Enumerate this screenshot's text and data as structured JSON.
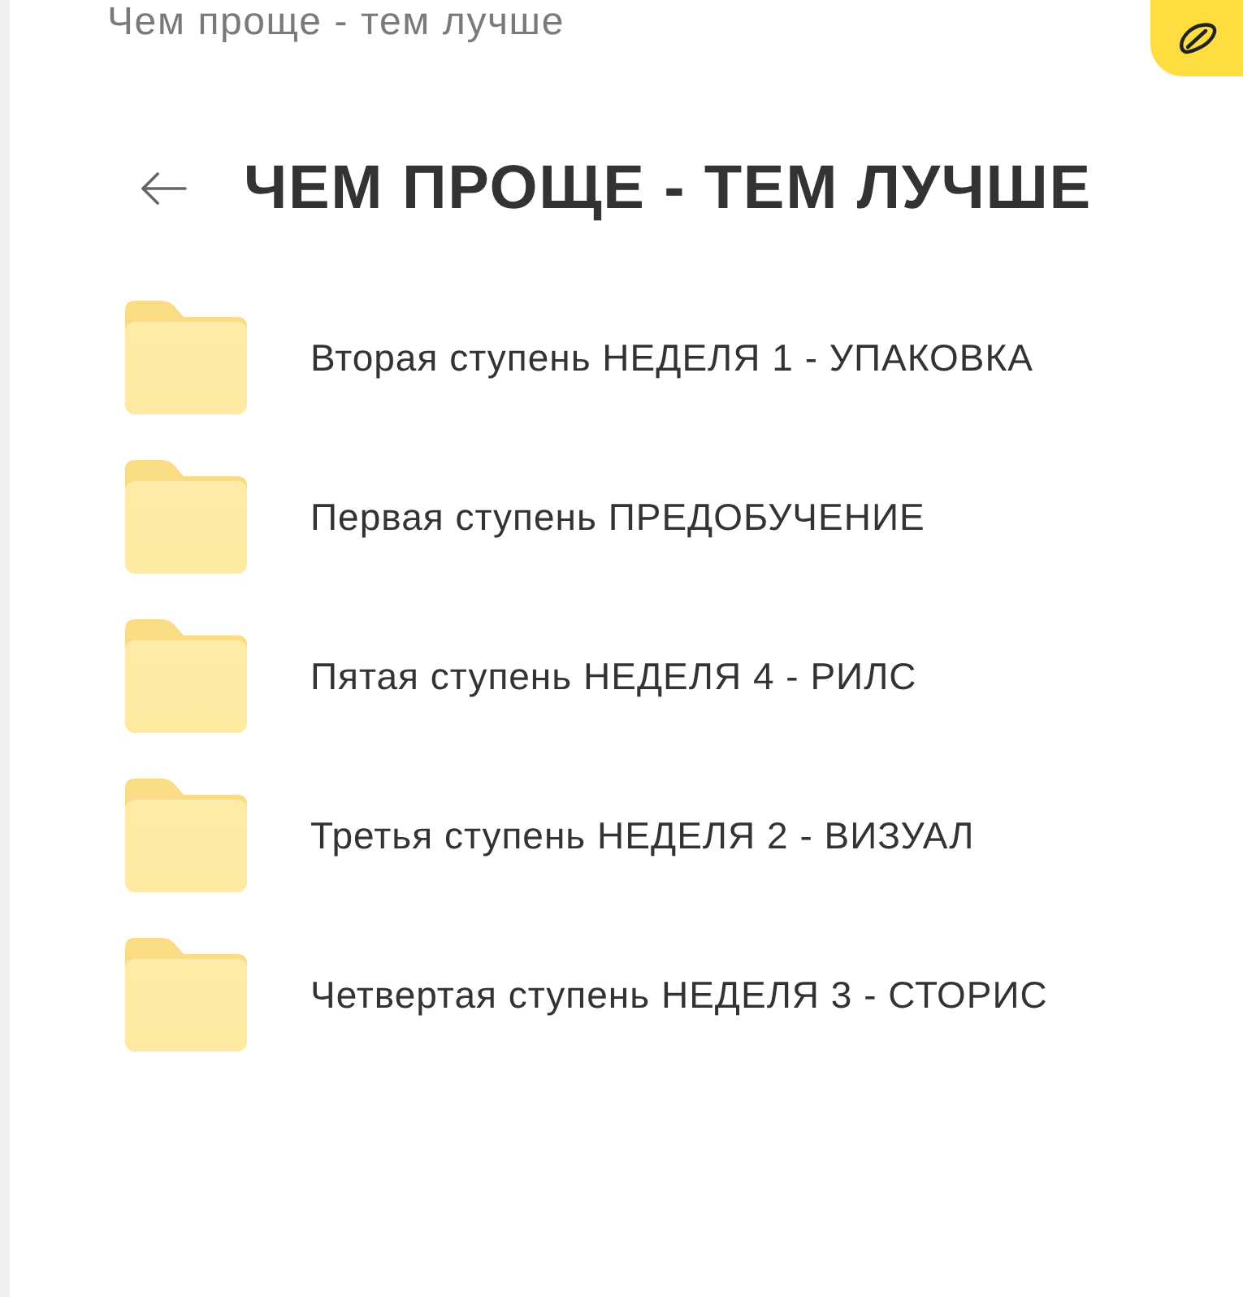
{
  "header": {
    "breadcrumb": "Чем проще - тем лучше"
  },
  "page": {
    "title": "ЧЕМ ПРОЩЕ - ТЕМ ЛУЧШЕ"
  },
  "folders": [
    {
      "name": "Вторая ступень НЕДЕЛЯ 1 - УПАКОВКА"
    },
    {
      "name": "Первая ступень ПРЕДОБУЧЕНИЕ"
    },
    {
      "name": "Пятая ступень НЕДЕЛЯ 4 - РИЛС"
    },
    {
      "name": "Третья ступень НЕДЕЛЯ 2 - ВИЗУАЛ"
    },
    {
      "name": "Четвертая ступень НЕДЕЛЯ 3 - СТОРИС"
    }
  ]
}
